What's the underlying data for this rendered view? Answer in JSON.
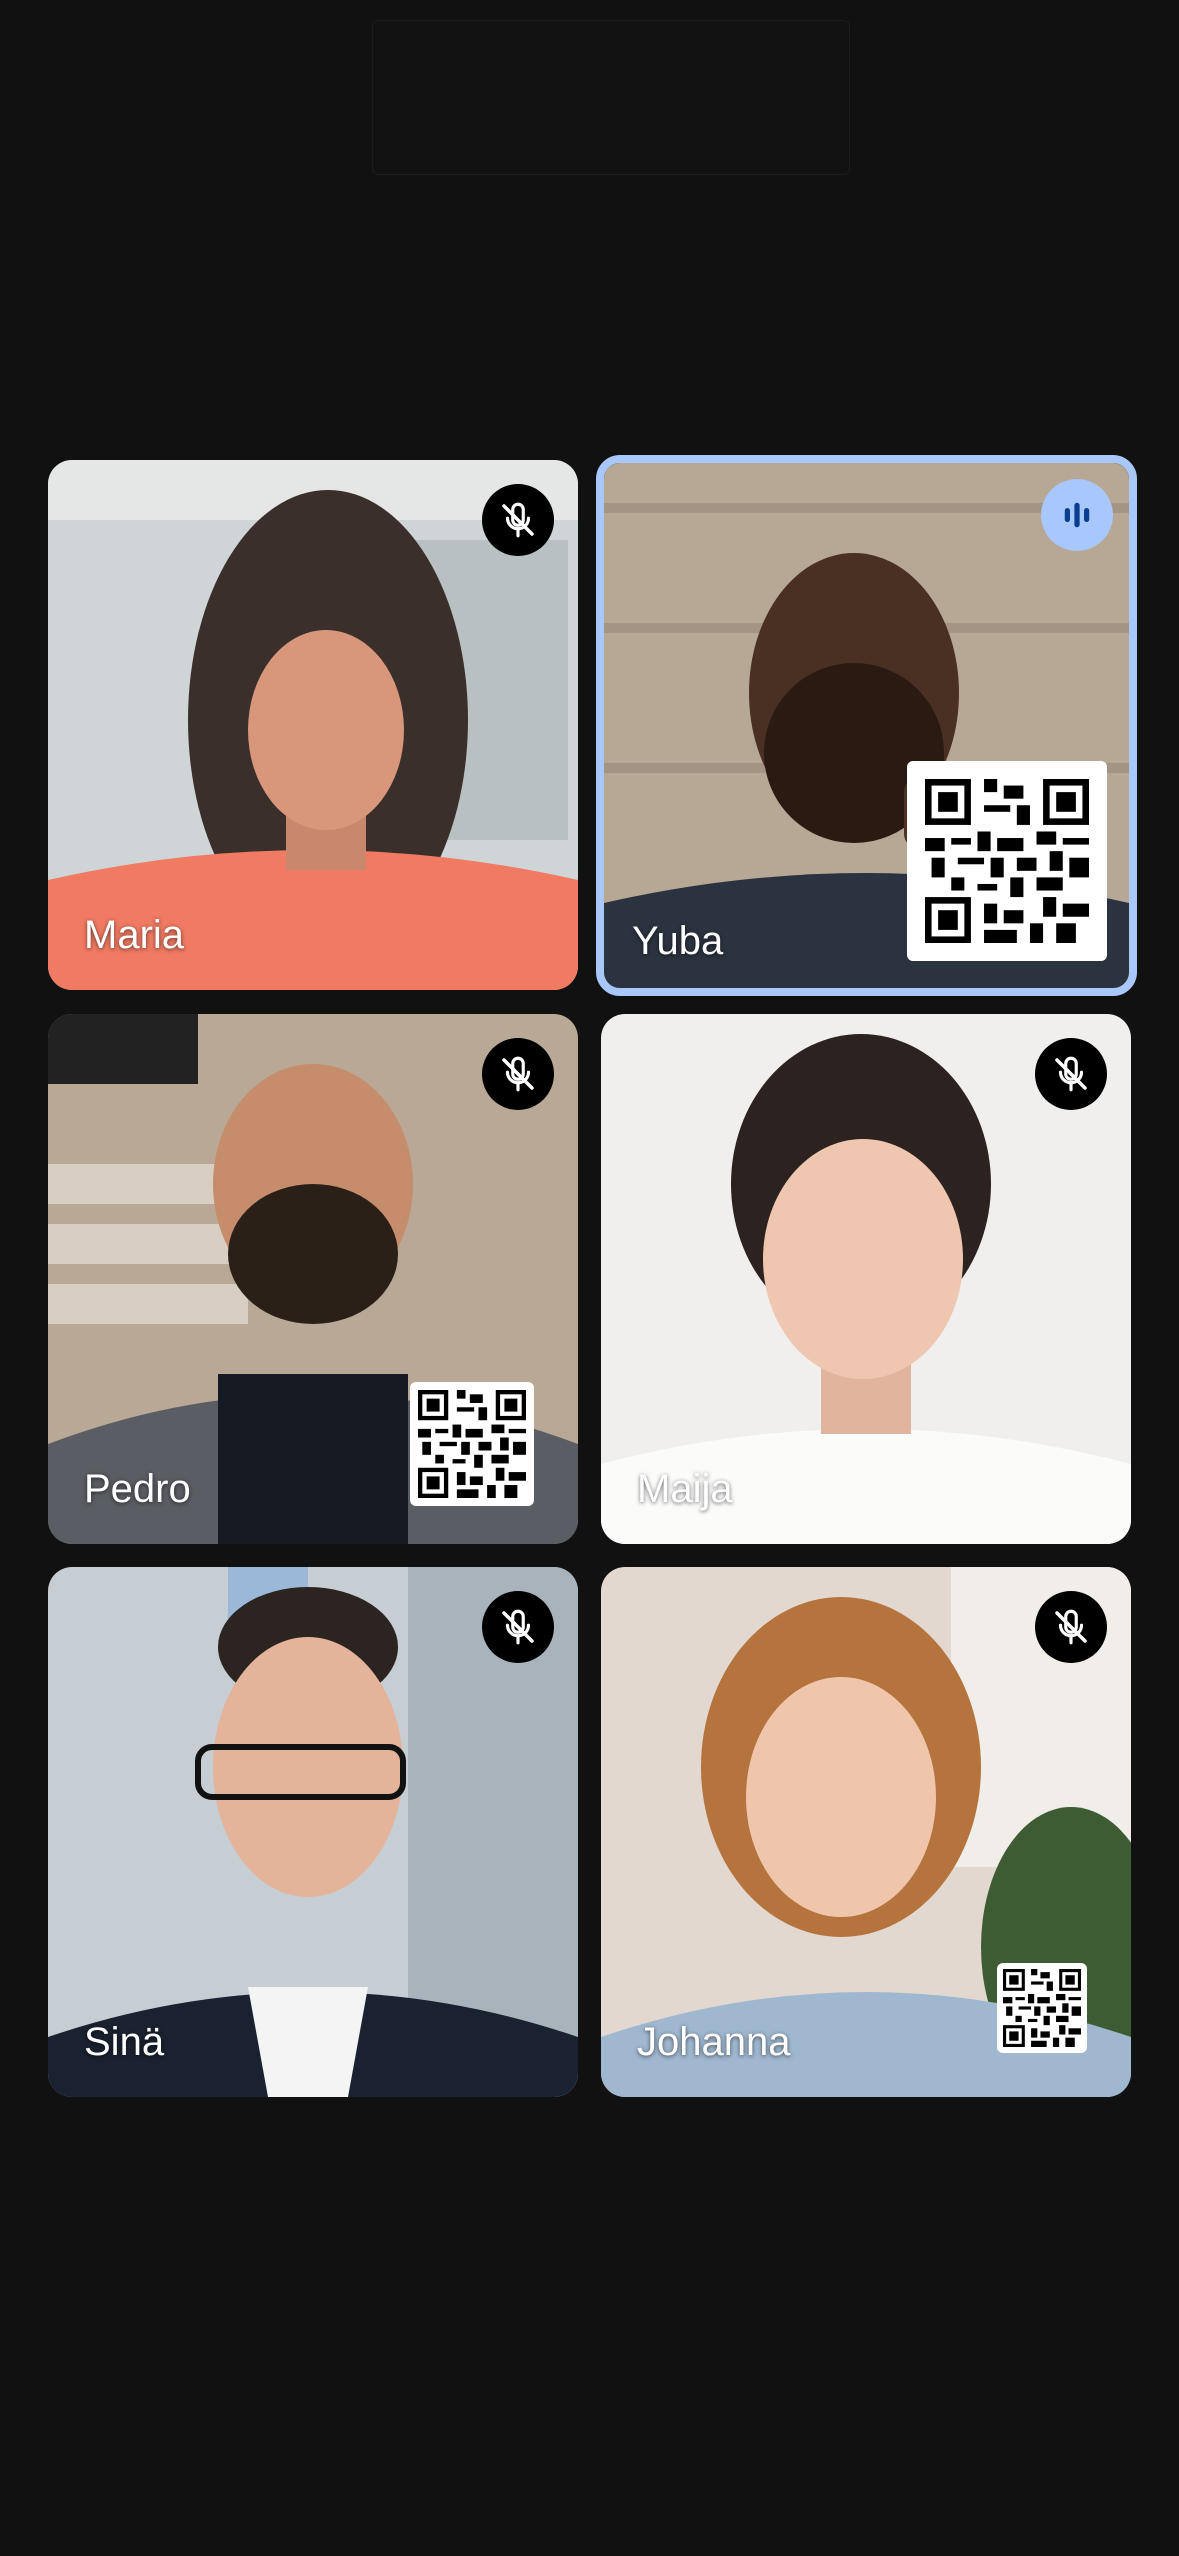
{
  "participants": [
    {
      "name": "Maria",
      "mic": "muted",
      "mic_icon": "mic-off-icon",
      "speaking": false
    },
    {
      "name": "Yuba",
      "mic": "speaking",
      "mic_icon": "audio-level-icon",
      "speaking": true
    },
    {
      "name": "Pedro",
      "mic": "muted",
      "mic_icon": "mic-off-icon",
      "speaking": false
    },
    {
      "name": "Maija",
      "mic": "muted",
      "mic_icon": "mic-off-icon",
      "speaking": false
    },
    {
      "name": "Sinä",
      "mic": "muted",
      "mic_icon": "mic-off-icon",
      "speaking": false
    },
    {
      "name": "Johanna",
      "mic": "muted",
      "mic_icon": "mic-off-icon",
      "speaking": false
    }
  ],
  "colors": {
    "background": "#111111",
    "speaking_border": "#a8c7fa",
    "speaking_badge": "#a8c7fa",
    "muted_badge": "#000000"
  }
}
